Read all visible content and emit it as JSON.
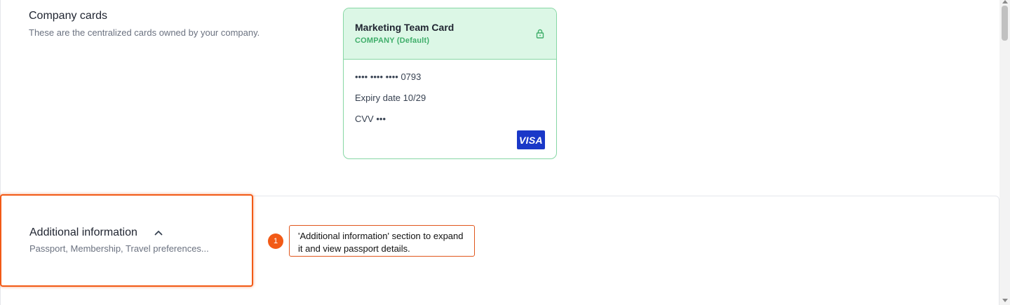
{
  "company_cards": {
    "title": "Company cards",
    "description": "These are the centralized cards owned by your company."
  },
  "card": {
    "name": "Marketing Team Card",
    "type": "COMPANY (Default)",
    "number": "•••• •••• •••• 0793",
    "expiry": "Expiry date 10/29",
    "cvv": "CVV •••",
    "brand": "VISA",
    "lock_icon": "lock-icon"
  },
  "additional_info": {
    "title": "Additional information",
    "subtitle": "Passport, Membership, Travel preferences...",
    "toggle_icon": "chevron-up-icon"
  },
  "annotation": {
    "number": "1",
    "text": "'Additional information' section to expand it and view passport details."
  },
  "colors": {
    "accent": "#f25a16",
    "card_border": "#86d7a4",
    "card_header": "#dcf7e6",
    "card_type": "#3fae6a",
    "visa": "#1a38c8"
  }
}
